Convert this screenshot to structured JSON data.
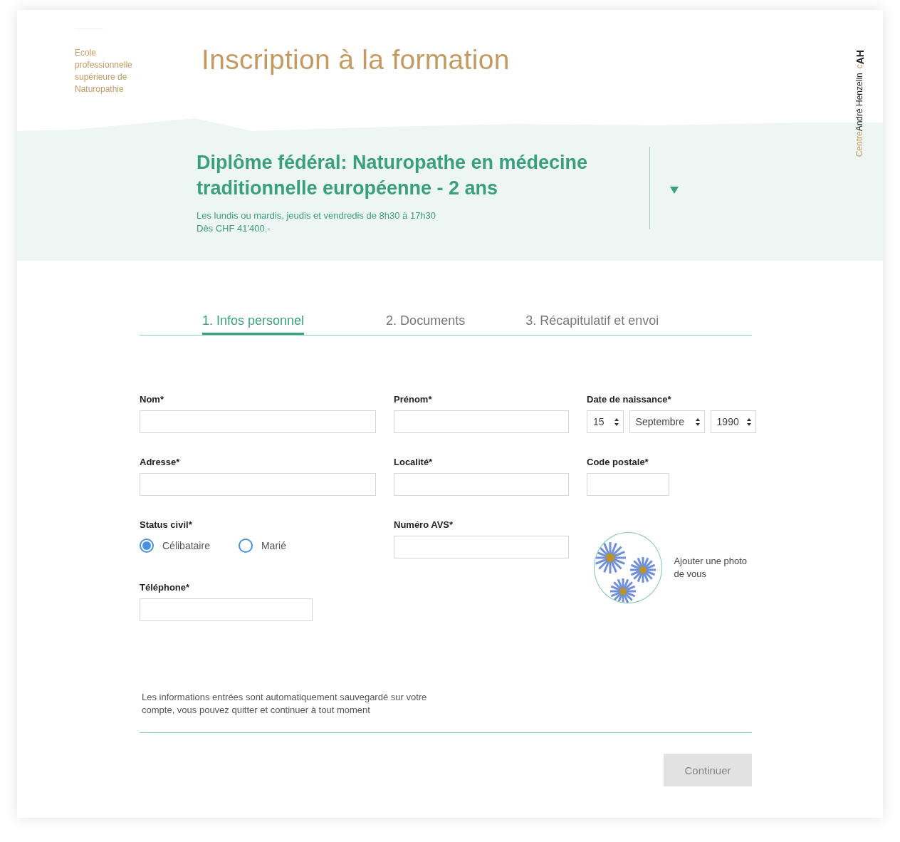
{
  "school": "Ecole professionnelle supérieure de Naturopathie",
  "title": "Inscription à la formation",
  "brand": [
    {
      "text": "Centre",
      "accent": true
    },
    {
      "text": "André Henzelin",
      "accent": false
    },
    {
      "text": "c",
      "accent": true
    },
    {
      "text": "AH",
      "accent": false
    }
  ],
  "course": {
    "title": "Diplôme fédéral: Naturopathe en médecine traditionnelle européenne - 2 ans",
    "schedule": "Les lundis ou mardis, jeudis et vendredis de 8h30 à 17h30",
    "price": "Dès CHF 41'400.-",
    "expanded": false
  },
  "tabs": [
    {
      "label": "1. Infos personnel",
      "selected": true
    },
    {
      "label": "2. Documents",
      "selected": false
    },
    {
      "label": "3. Récapitulatif et envoi",
      "selected": false
    }
  ],
  "rows": [
    [
      {
        "kind": "text",
        "label": "Nom*"
      },
      {
        "kind": "text",
        "label": "Prénom*"
      },
      {
        "kind": "date",
        "label": "Date de naissance*",
        "day": "15",
        "month": "Septembre",
        "year": "1990"
      }
    ],
    [
      {
        "kind": "text",
        "label": "Adresse*"
      },
      {
        "kind": "text",
        "label": "Localité*"
      },
      {
        "kind": "text",
        "label": "Code postale*"
      }
    ],
    [
      {
        "kind": "choice",
        "label": "Status civil*",
        "options": [
          {
            "label": "Célibataire",
            "selected": true
          },
          {
            "label": "Marié",
            "selected": false
          }
        ]
      },
      {
        "kind": "text",
        "label": "Numéro AVS*"
      },
      {
        "kind": "photo",
        "label": "Ajouter une photo de vous"
      }
    ],
    [
      {
        "kind": "text",
        "label": "Téléphone*"
      }
    ]
  ],
  "notice": "Les informations entrées sont automatiquement sauvegardé sur votre compte, vous pouvez quitter et continuer à tout moment",
  "submit": {
    "label": "Continuer",
    "disabled": true
  }
}
